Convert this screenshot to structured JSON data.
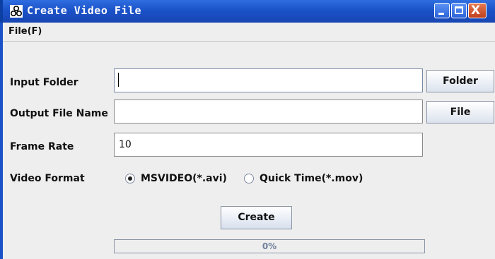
{
  "window": {
    "title": "Create Video File",
    "icon": "app-trefoil-icon",
    "controls": {
      "minimize": "minimize-icon",
      "maximize": "maximize-icon",
      "close": "close-icon",
      "close_glyph": "X"
    }
  },
  "menubar": {
    "file_menu": "File(F)"
  },
  "form": {
    "input_folder": {
      "label": "Input Folder",
      "value": "",
      "button": "Folder"
    },
    "output_file": {
      "label": "Output File Name",
      "value": "",
      "button": "File"
    },
    "frame_rate": {
      "label": "Frame Rate",
      "value": "10"
    },
    "video_format": {
      "label": "Video Format",
      "options": [
        {
          "label": "MSVIDEO(*.avi)",
          "selected": true
        },
        {
          "label": "Quick Time(*.mov)",
          "selected": false
        }
      ]
    },
    "create_button": "Create",
    "progress": {
      "percent": 0,
      "text": "0%"
    }
  },
  "colors": {
    "titlebar": "#1b52c9",
    "close_button": "#c0401e",
    "window_bg": "#eeeeee",
    "progress_text": "#6f7f9a"
  }
}
